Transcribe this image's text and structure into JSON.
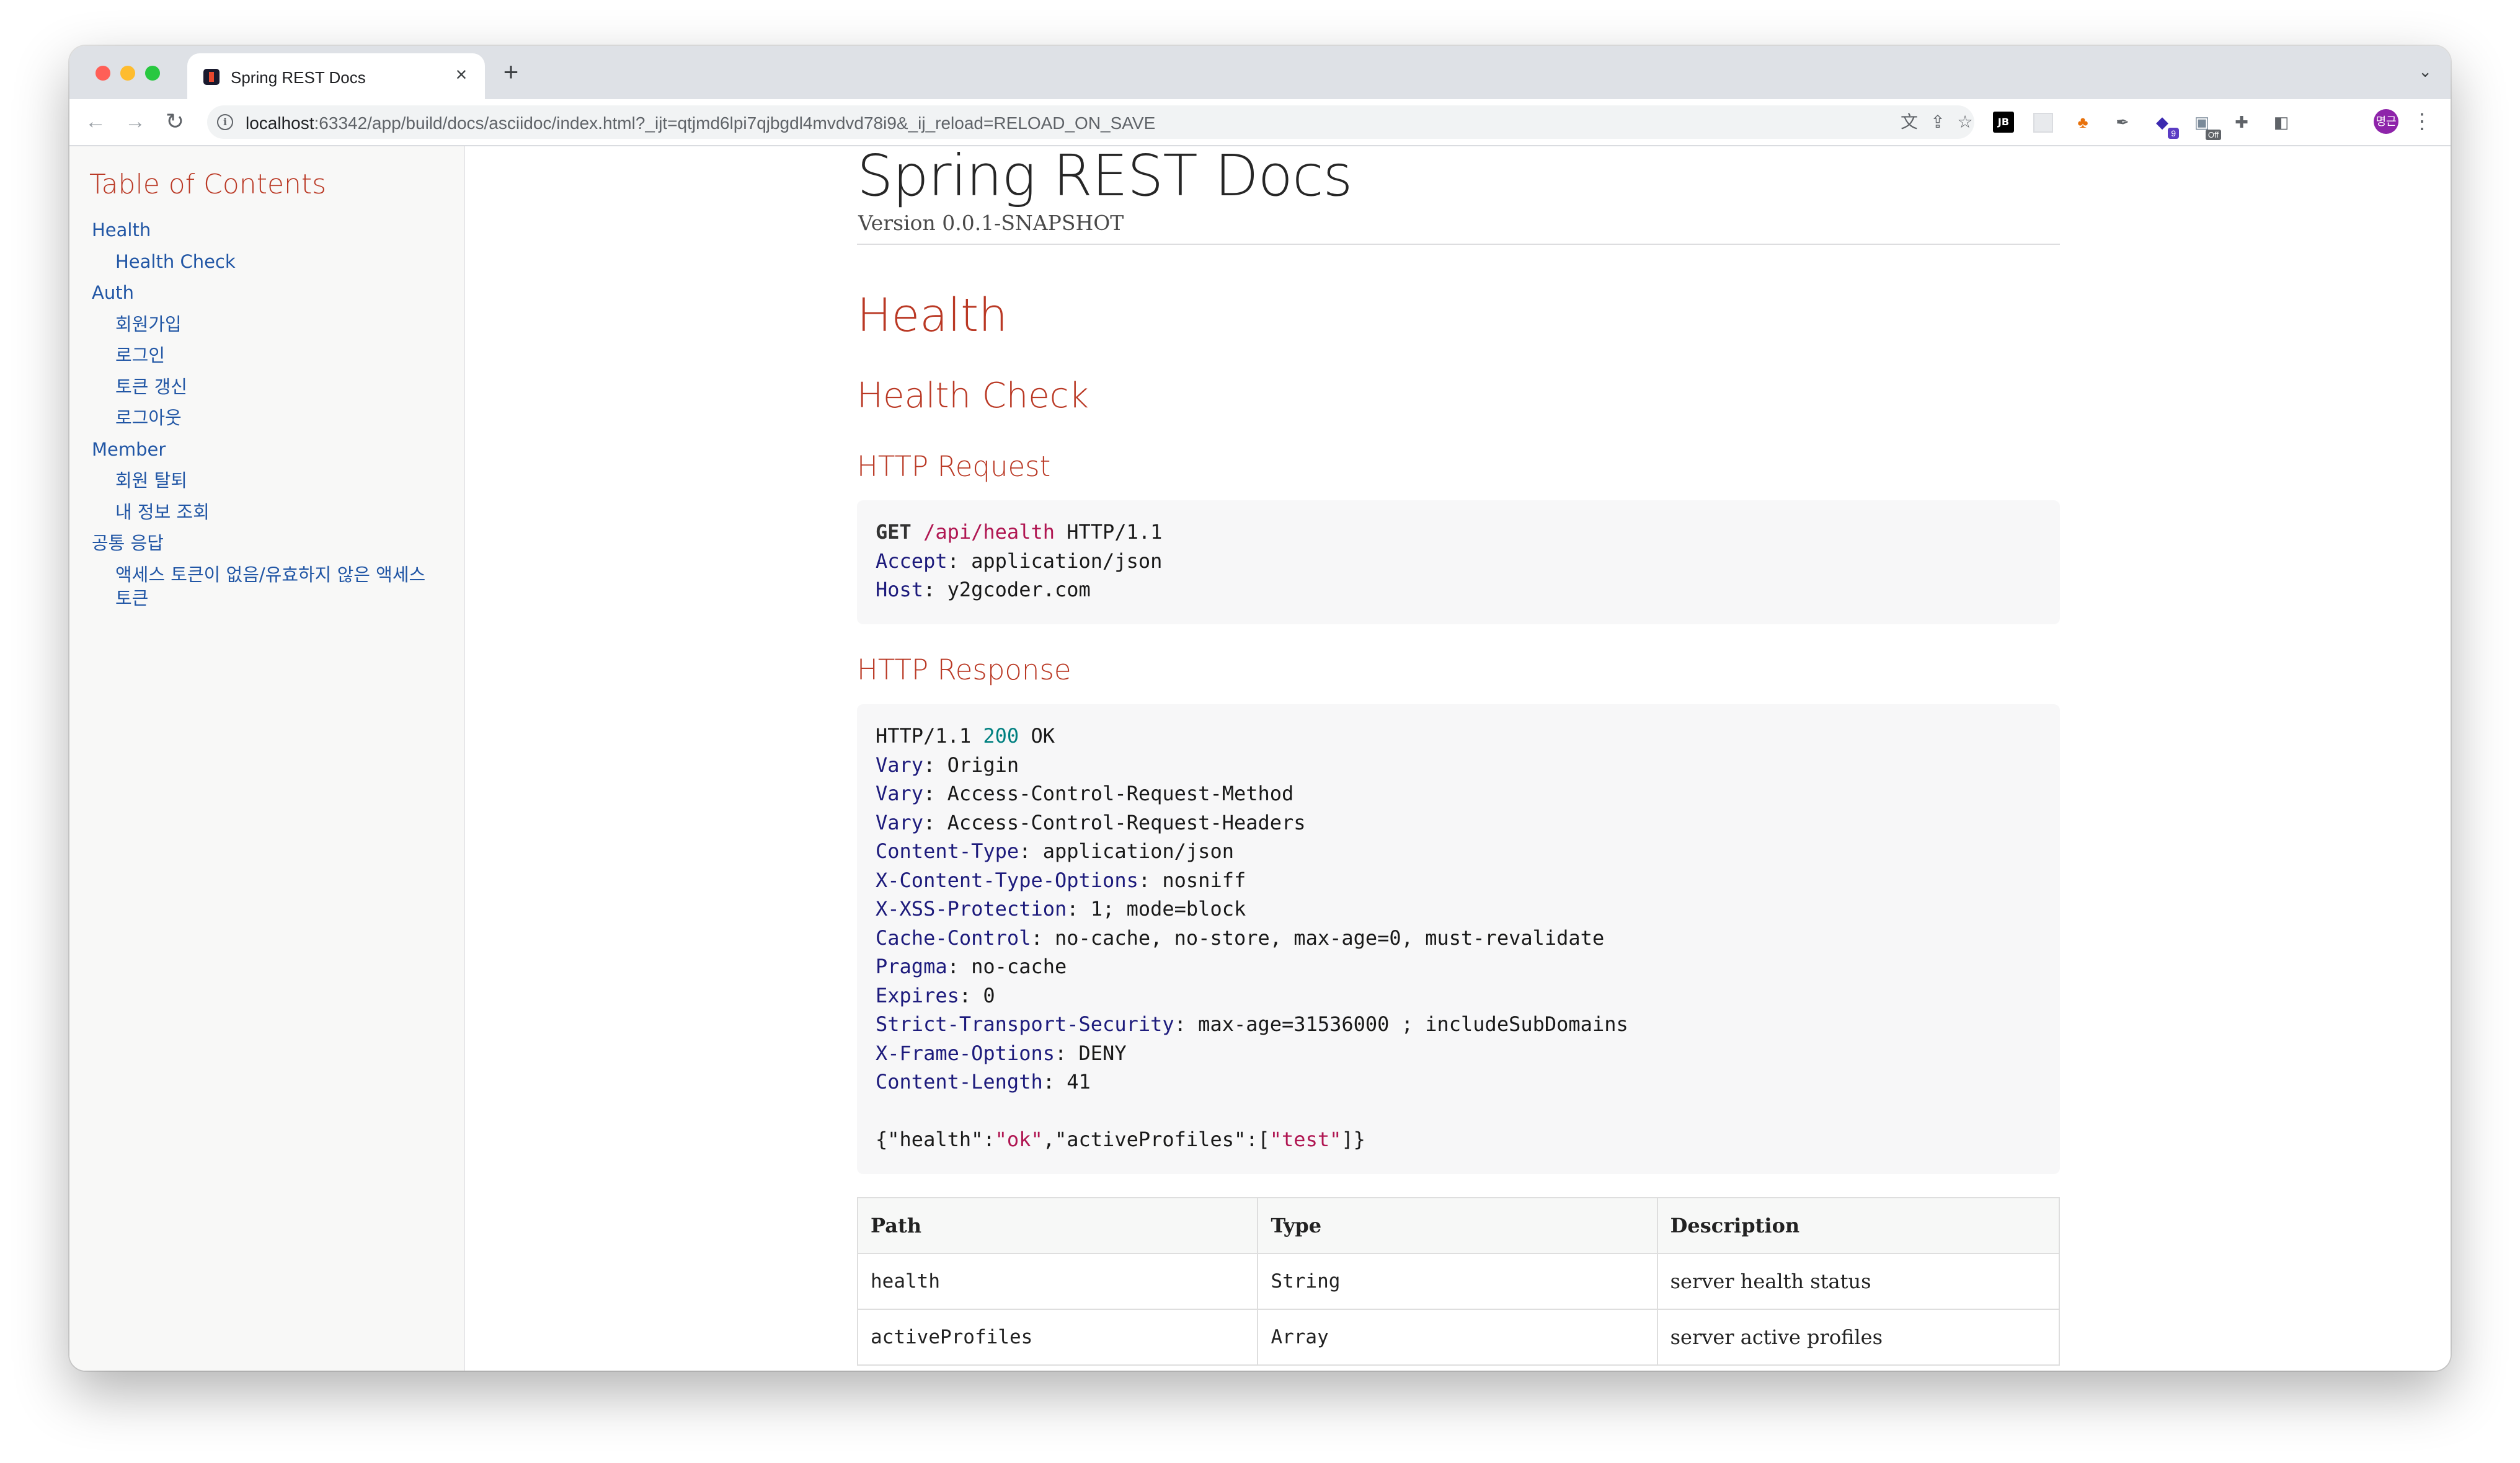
{
  "browser": {
    "tab_title": "Spring REST Docs",
    "tab_close": "×",
    "new_tab": "+",
    "tab_menu": "⌄",
    "url_host": "localhost",
    "url_rest": ":63342/app/build/docs/asciidoc/index.html?_ijt=qtjmd6lpi7qjbgdl4mvdvd78i9&_ij_reload=RELOAD_ON_SAVE",
    "back": "←",
    "forward": "→",
    "reload": "↻",
    "extension_badges": {
      "count": "9",
      "off": "Off"
    },
    "profile_initials": "명근",
    "menu": "⋮"
  },
  "toc": {
    "title": "Table of Contents",
    "items": [
      {
        "label": "Health",
        "level": 1
      },
      {
        "label": "Health Check",
        "level": 2
      },
      {
        "label": "Auth",
        "level": 1
      },
      {
        "label": "회원가입",
        "level": 2
      },
      {
        "label": "로그인",
        "level": 2
      },
      {
        "label": "토큰 갱신",
        "level": 2
      },
      {
        "label": "로그아웃",
        "level": 2
      },
      {
        "label": "Member",
        "level": 1
      },
      {
        "label": "회원 탈퇴",
        "level": 2
      },
      {
        "label": "내 정보 조회",
        "level": 2
      },
      {
        "label": "공통 응답",
        "level": 1
      },
      {
        "label": "액세스 토큰이 없음/유효하지 않은 액세스 토큰",
        "level": 2
      }
    ]
  },
  "doc": {
    "title": "Spring REST Docs",
    "version": "Version 0.0.1-SNAPSHOT",
    "section": "Health",
    "subsection": "Health Check",
    "request_heading": "HTTP Request",
    "request": {
      "method": "GET",
      "path": "/api/health",
      "protocol": "HTTP/1.1",
      "headers": [
        {
          "name": "Accept",
          "value": "application/json"
        },
        {
          "name": "Host",
          "value": "y2gcoder.com"
        }
      ]
    },
    "response_heading": "HTTP Response",
    "response": {
      "protocol": "HTTP/1.1",
      "status_code": "200",
      "status_text": "OK",
      "headers": [
        {
          "name": "Vary",
          "value": "Origin"
        },
        {
          "name": "Vary",
          "value": "Access-Control-Request-Method"
        },
        {
          "name": "Vary",
          "value": "Access-Control-Request-Headers"
        },
        {
          "name": "Content-Type",
          "value": "application/json"
        },
        {
          "name": "X-Content-Type-Options",
          "value": "nosniff"
        },
        {
          "name": "X-XSS-Protection",
          "value": "1; mode=block"
        },
        {
          "name": "Cache-Control",
          "value": "no-cache, no-store, max-age=0, must-revalidate"
        },
        {
          "name": "Pragma",
          "value": "no-cache"
        },
        {
          "name": "Expires",
          "value": "0"
        },
        {
          "name": "Strict-Transport-Security",
          "value": "max-age=31536000 ; includeSubDomains"
        },
        {
          "name": "X-Frame-Options",
          "value": "DENY"
        },
        {
          "name": "Content-Length",
          "value": "41"
        }
      ],
      "body": {
        "p1": "{\"health\":",
        "s1": "\"ok\"",
        "p2": ",\"activeProfiles\":[",
        "s2": "\"test\"",
        "p3": "]}"
      }
    },
    "fields_table": {
      "columns": [
        "Path",
        "Type",
        "Description"
      ],
      "rows": [
        [
          "health",
          "String",
          "server health status"
        ],
        [
          "activeProfiles",
          "Array",
          "server active profiles"
        ]
      ]
    }
  }
}
